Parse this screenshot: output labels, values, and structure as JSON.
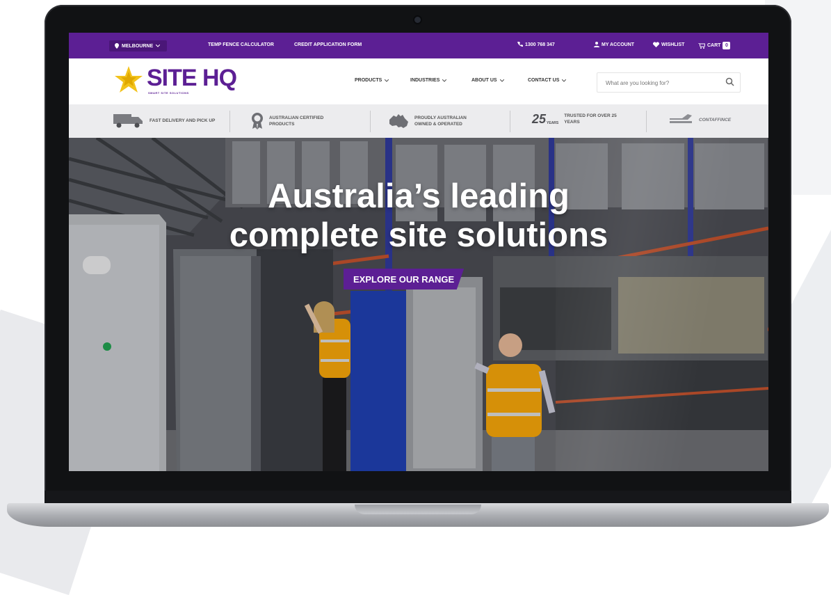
{
  "topbar": {
    "location": "MELBOURNE",
    "links": [
      "TEMP FENCE CALCULATOR",
      "CREDIT APPLICATION FORM"
    ],
    "phone": "1300 768 347",
    "account": "MY ACCOUNT",
    "wishlist": "WISHLIST",
    "cart": "CART",
    "cart_count": "0"
  },
  "header": {
    "logo_text": "SITE HQ",
    "logo_tagline": "SMART SITE SOLUTIONS",
    "nav": [
      "PRODUCTS",
      "INDUSTRIES",
      "ABOUT US",
      "CONTACT US"
    ],
    "search_placeholder": "What are you looking for?"
  },
  "features": [
    {
      "icon": "truck-icon",
      "text": "FAST DELIVERY AND PICK UP"
    },
    {
      "icon": "certified-badge-icon",
      "text": "AUSTRALIAN CERTIFIED PRODUCTS"
    },
    {
      "icon": "australia-map-icon",
      "text": "PROUDLY AUSTRALIAN OWNED & OPERATED"
    },
    {
      "icon": "25-years-icon",
      "text": "TRUSTED FOR OVER 25 YEARS",
      "badge": "25",
      "badge_sub": "YEARS"
    },
    {
      "icon": "partner-logo-icon",
      "text": "CONTAFFINCE"
    }
  ],
  "hero": {
    "title_line1": "Australia’s leading",
    "title_line2": "complete site solutions",
    "cta": "EXPLORE OUR RANGE"
  },
  "colors": {
    "brand_purple": "#5c1f94",
    "logo_yellow": "#f2c21b",
    "safety_orange": "#f5a300"
  }
}
